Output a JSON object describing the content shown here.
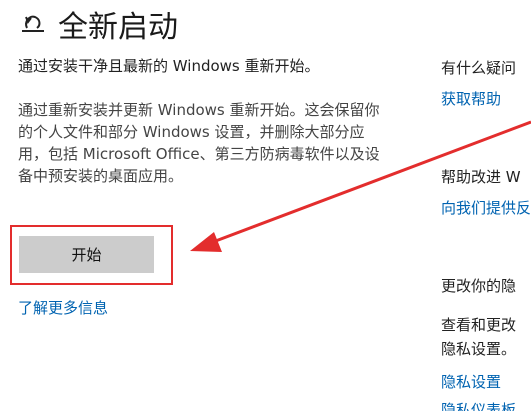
{
  "header": {
    "icon": "reset-icon",
    "title": "全新启动"
  },
  "main": {
    "subtitle": "通过安装干净且最新的 Windows 重新开始。",
    "description": "通过重新安装并更新 Windows 重新开始。这会保留你的个人文件和部分 Windows 设置，并删除大部分应用，包括 Microsoft Office、第三方防病毒软件以及设备中预安装的桌面应用。",
    "start_button": "开始",
    "learn_more": "了解更多信息"
  },
  "sidebar": {
    "q_heading": "有什么疑问",
    "get_help": "获取帮助",
    "improve_heading": "帮助改进 W",
    "feedback_link": "向我们提供反",
    "privacy_heading": "更改你的隐",
    "privacy_text_1": "查看和更改",
    "privacy_text_2": "隐私设置。",
    "privacy_settings": "隐私设置",
    "privacy_dashboard": "隐私仪表板"
  },
  "annotation": {
    "color": "#e32d2d"
  }
}
